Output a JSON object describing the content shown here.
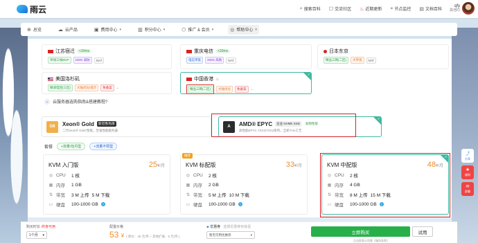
{
  "brand": {
    "name": "雨云"
  },
  "top_links": [
    {
      "icon": "search-icon",
      "label": "搜索百科"
    },
    {
      "icon": "chat-icon",
      "label": "交流社区"
    },
    {
      "icon": "fire-icon",
      "label": "近期更新"
    },
    {
      "icon": "pin-icon",
      "label": "节点监控"
    },
    {
      "icon": "doc-icon",
      "label": "文档百科"
    }
  ],
  "user": {
    "name": "qfy",
    "sub": "其他ID"
  },
  "nav": [
    {
      "icon": "home-icon",
      "label": "总览",
      "dropdown": false,
      "active": false
    },
    {
      "icon": "cloud-icon",
      "label": "云产品",
      "dropdown": false,
      "active": false
    },
    {
      "icon": "wallet-icon",
      "label": "费用中心",
      "dropdown": true,
      "active": false
    },
    {
      "icon": "points-icon",
      "label": "积分中心",
      "dropdown": true,
      "active": false
    },
    {
      "icon": "affiliate-icon",
      "label": "推广 & 会员",
      "dropdown": true,
      "active": false
    },
    {
      "icon": "help-icon",
      "label": "帮助中心",
      "dropdown": true,
      "active": true
    }
  ],
  "regions": [
    {
      "name": "江苏宿迁",
      "flag": "cn",
      "ping": "<30ms",
      "tags": [
        {
          "t": "单线三线BGP",
          "c": "g"
        },
        {
          "t": "150G 高防",
          "c": "p"
        },
        {
          "t": "NAT",
          "c": "gr"
        }
      ]
    },
    {
      "name": "重庆电信",
      "flag": "cn",
      "ping": "<30ms",
      "tags": [
        {
          "t": "电信带宽",
          "c": "b"
        },
        {
          "t": "200G 高防",
          "c": "p"
        },
        {
          "t": "NAT",
          "c": "gr"
        }
      ]
    },
    {
      "name": "日本东京",
      "flag": "jp",
      "ping": "",
      "tags": [
        {
          "t": "精品三网(二区)",
          "c": "g"
        },
        {
          "t": "大带宽",
          "c": "o"
        },
        {
          "t": "NAT",
          "c": "gr"
        }
      ]
    },
    {
      "name": "美国洛杉矶",
      "flag": "us",
      "ping": "",
      "tags": [
        {
          "t": "精调电回(三区)",
          "c": "g"
        },
        {
          "t": "大陆优化/提示",
          "c": "o"
        },
        {
          "t": "免备案",
          "c": "r"
        }
      ]
    },
    {
      "name": "中国香港",
      "flag": "cn",
      "ping": "",
      "tags": [
        {
          "t": "精品三网(二区)",
          "c": "g"
        },
        {
          "t": "大陆优化",
          "c": "o"
        },
        {
          "t": "免备案",
          "c": "r"
        }
      ]
    }
  ],
  "tips": {
    "label": "云服务器选购指南&搭建教程?"
  },
  "cpus": [
    {
      "badge": "G6",
      "badge_color": "#f1b04b",
      "name": "Xeon® Gold",
      "tag": "新可用/有库",
      "sub": "二代Xeon® Gold 性能，至强性能服务器"
    },
    {
      "badge": "A",
      "badge_color": "#2c2c2c",
      "name": "AMD® EPYC",
      "tag": "企业 NVME SSD",
      "tag2": "高频性能",
      "sub": "高性能EPYC 7XX2/7XX3系列，全新7nm工艺"
    }
  ],
  "plan_tabs": {
    "label": "套餐",
    "tab1": "+流量/包月型",
    "tab2": "+流量不限型"
  },
  "plans": [
    {
      "name": "KVM 入门版",
      "price": "25",
      "unit": "¥/月",
      "cpu": "1 核",
      "mem": "1 GB",
      "bw_up": "3 M 上传",
      "bw_down": "5 M 下载",
      "disk": "100-1000 GB",
      "hot": ""
    },
    {
      "name": "KVM 标配版",
      "price": "33",
      "unit": "¥/月",
      "cpu": "2 核",
      "mem": "2 GB",
      "bw_up": "5 M 上传",
      "bw_down": "10 M 下载",
      "disk": "100-1000 GB",
      "hot": "推荐"
    },
    {
      "name": "KVM 中配版",
      "price": "48",
      "unit": "¥/月",
      "cpu": "2 核",
      "mem": "4 GB",
      "bw_up": "8 M 上传",
      "bw_down": "15 M 下载",
      "disk": "100-1000 GB",
      "hot": ""
    }
  ],
  "spec_labels": {
    "cpu": "CPU",
    "mem": "内存",
    "bw": "带宽",
    "disk": "硬盘"
  },
  "side": [
    {
      "icon": "share-icon",
      "label": "分享",
      "color": "#3b82f6"
    },
    {
      "icon": "gift-icon",
      "label": "福利",
      "color": "#ef4444"
    },
    {
      "icon": "wx-icon",
      "label": "群聊",
      "color": "#ef4444"
    }
  ],
  "bottom": {
    "duration_label": "购买时长",
    "duration_note": "终身可用",
    "duration_value": "1个月",
    "price_label": "配置价格",
    "price": "53",
    "price_unit": "¥",
    "price_note": "( 原价：48 元/月 + 其他扩展：5 元/月 )",
    "coupon_label": "优惠券",
    "coupon_hint": "选择优惠券有惊喜",
    "coupon_value": "暂无可用优惠券",
    "buy_label": "立即购买",
    "try_label": "试用",
    "agree": "点击即表示同意《服务条款》"
  }
}
